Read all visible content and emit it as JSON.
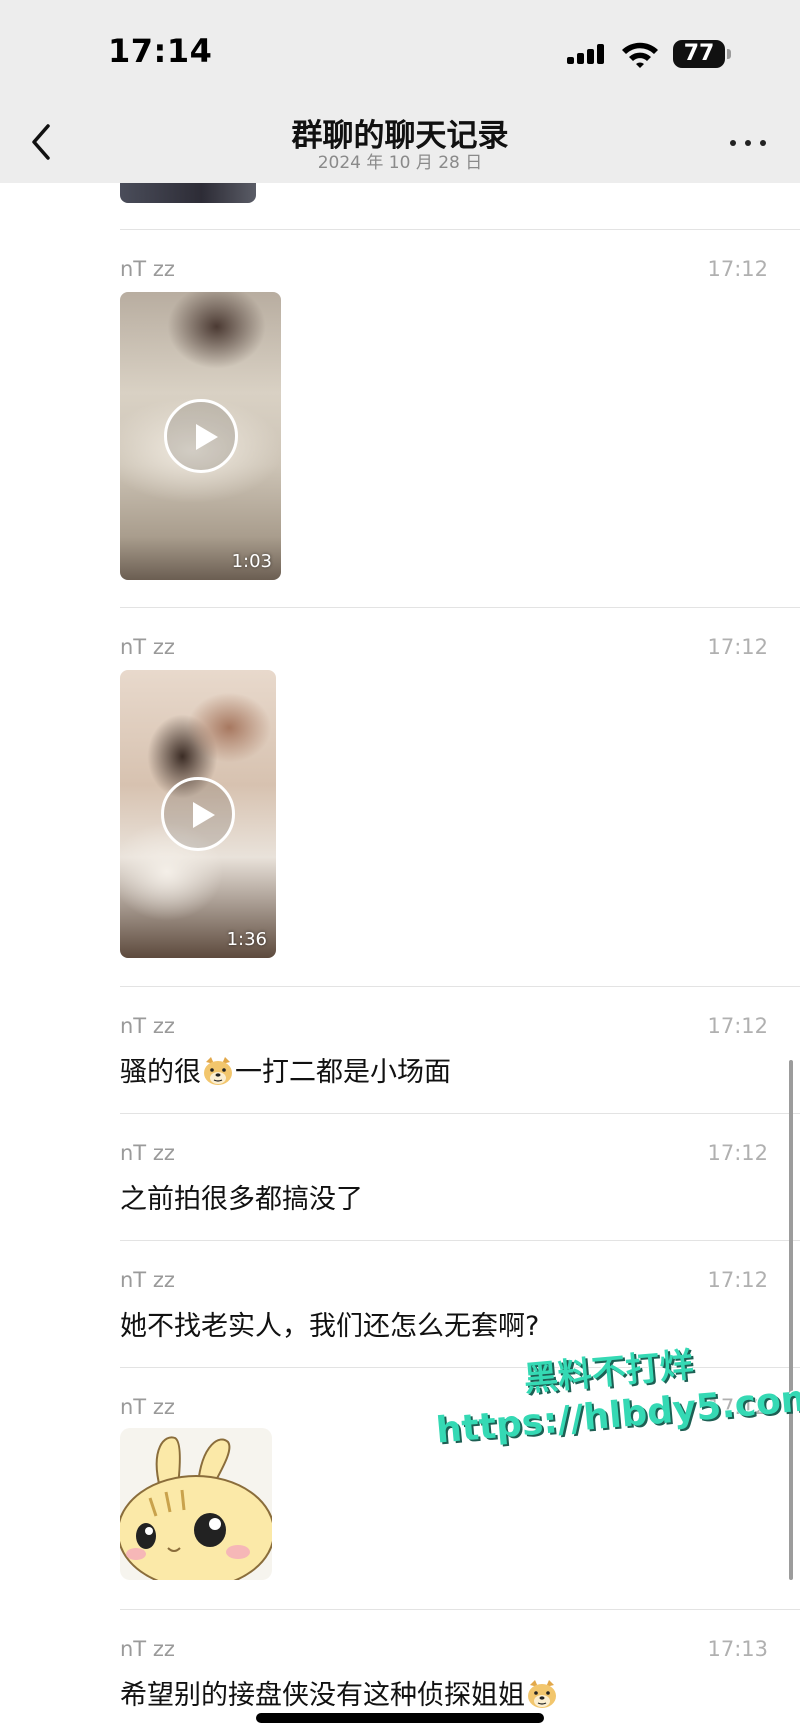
{
  "status_bar": {
    "time": "17:14",
    "battery": "77"
  },
  "nav": {
    "title": "群聊的聊天记录",
    "date": "2024 年 10 月 28 日",
    "back_icon": "chevron-left-icon",
    "more_icon": "more-dots-icon"
  },
  "messages": [
    {
      "sender": "nT zz",
      "time": "17:12",
      "type": "video",
      "duration": "1:03"
    },
    {
      "sender": "nT zz",
      "time": "17:12",
      "type": "video",
      "duration": "1:36"
    },
    {
      "sender": "nT zz",
      "time": "17:12",
      "type": "text",
      "text_before": "骚的很",
      "emoji": "doge-emoji",
      "text_after": "一打二都是小场面"
    },
    {
      "sender": "nT zz",
      "time": "17:12",
      "type": "text",
      "text": "之前拍很多都搞没了"
    },
    {
      "sender": "nT zz",
      "time": "17:12",
      "type": "text",
      "text": "她不找老实人，我们还怎么无套啊?"
    },
    {
      "sender": "nT zz",
      "time": "17:12",
      "type": "sticker",
      "sticker": "bunny-sticker"
    },
    {
      "sender": "nT zz",
      "time": "17:13",
      "type": "text",
      "text_before": "希望别的接盘侠没有这种侦探姐姐",
      "emoji": "doge-emoji"
    }
  ],
  "watermark": {
    "line1": "黑料不打烊",
    "line2": "https://hlbdy5.com"
  },
  "colors": {
    "header_bg": "#ededed",
    "watermark": "#35d9b4"
  }
}
